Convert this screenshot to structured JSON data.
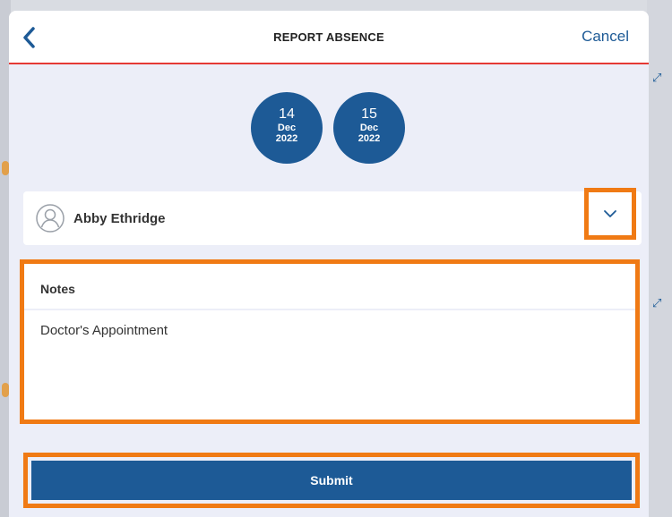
{
  "header": {
    "title": "REPORT ABSENCE",
    "cancel_label": "Cancel",
    "back_icon": "chevron-left-icon"
  },
  "dates": [
    {
      "day": "14",
      "month": "Dec",
      "year": "2022"
    },
    {
      "day": "15",
      "month": "Dec",
      "year": "2022"
    }
  ],
  "person": {
    "name": "Abby Ethridge",
    "avatar_icon": "user-avatar-icon",
    "dropdown_icon": "chevron-down-icon"
  },
  "notes": {
    "label": "Notes",
    "value": "Doctor's Appointment"
  },
  "submit": {
    "label": "Submit"
  },
  "colors": {
    "primary": "#1d5a96",
    "highlight": "#f07a14",
    "header_rule": "#e53935",
    "modal_bg": "#eceef8"
  }
}
